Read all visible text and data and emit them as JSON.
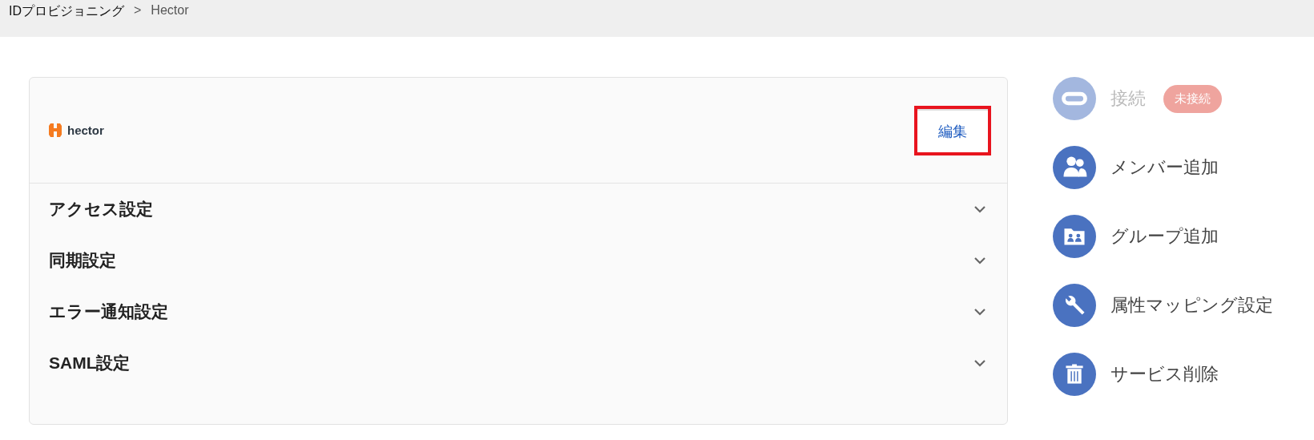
{
  "breadcrumb": [
    {
      "label": "IDプロビジョニング"
    },
    {
      "label": "Hector"
    }
  ],
  "breadcrumb_separator": ">",
  "service_card": {
    "logo_text": "hector",
    "edit_button": {
      "label": "編集",
      "highlighted": true
    },
    "sections": [
      {
        "title": "アクセス設定",
        "expanded": false
      },
      {
        "title": "同期設定",
        "expanded": false
      },
      {
        "title": "エラー通知設定",
        "expanded": false
      },
      {
        "title": "SAML設定",
        "expanded": false
      }
    ]
  },
  "actions": [
    {
      "kind": "connect",
      "label": "接続",
      "disabled": true,
      "badge": "未接続"
    },
    {
      "kind": "member",
      "label": "メンバー追加",
      "disabled": false
    },
    {
      "kind": "group",
      "label": "グループ追加",
      "disabled": false
    },
    {
      "kind": "mapping",
      "label": "属性マッピング設定",
      "disabled": false
    },
    {
      "kind": "delete",
      "label": "サービス削除",
      "disabled": false
    }
  ]
}
